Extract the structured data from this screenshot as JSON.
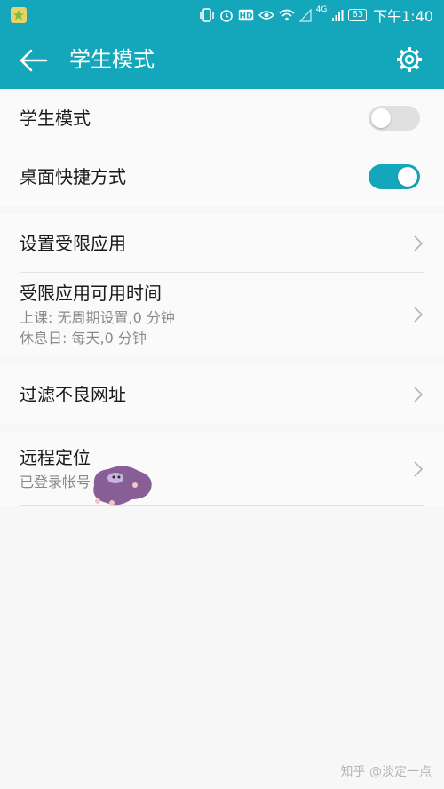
{
  "status_bar": {
    "network": "4G",
    "battery": "63",
    "time": "下午1:40"
  },
  "header": {
    "title": "学生模式",
    "back_icon": "arrow-back-icon",
    "settings_icon": "gear-icon"
  },
  "toggles": [
    {
      "label": "学生模式",
      "on": false
    },
    {
      "label": "桌面快捷方式",
      "on": true
    }
  ],
  "apps_section": {
    "restricted_apps": {
      "label": "设置受限应用"
    },
    "available_time": {
      "label": "受限应用可用时间",
      "lines": [
        "上课: 无周期设置,0 分钟",
        "休息日: 每天,0 分钟"
      ]
    }
  },
  "filter": {
    "label": "过滤不良网址"
  },
  "remote": {
    "label": "远程定位",
    "sub": "已登录帐号"
  },
  "watermark": "知乎 @淡定一点",
  "colors": {
    "accent": "#14a7bb",
    "toggle_on": "#14a7bb",
    "toggle_off": "#e0e0e0"
  }
}
